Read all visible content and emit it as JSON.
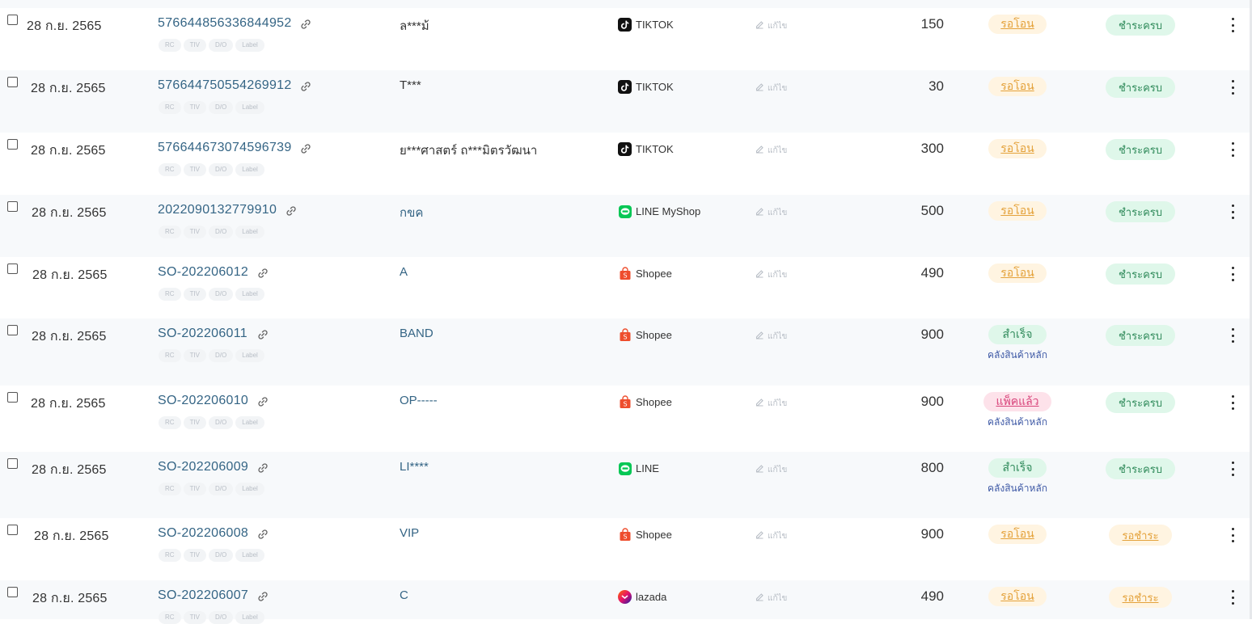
{
  "orders": {
    "tags": [
      "RC",
      "TIV",
      "D/O",
      "Label"
    ],
    "edit_label": "แก้ไข",
    "rows": [
      {
        "date": "28 ก.ย. 2565",
        "order_no": "576644856336844952",
        "customer": "ล***ม้",
        "customer_link": false,
        "platform": "TIKTOK",
        "platform_icon": "tiktok-icon",
        "amount": "150",
        "status": "รอโอน",
        "status_type": "wait",
        "warehouse": "",
        "payment": "ชำระครบ",
        "payment_type": "full"
      },
      {
        "date": "28 ก.ย. 2565",
        "order_no": "576644750554269912",
        "customer": "T***",
        "customer_link": false,
        "platform": "TIKTOK",
        "platform_icon": "tiktok-icon",
        "amount": "30",
        "status": "รอโอน",
        "status_type": "wait",
        "warehouse": "",
        "payment": "ชำระครบ",
        "payment_type": "full"
      },
      {
        "date": "28 ก.ย. 2565",
        "order_no": "576644673074596739",
        "customer": "ย***ศาสตร์ ถ***มิตรวัฒนา",
        "customer_link": false,
        "platform": "TIKTOK",
        "platform_icon": "tiktok-icon",
        "amount": "300",
        "status": "รอโอน",
        "status_type": "wait",
        "warehouse": "",
        "payment": "ชำระครบ",
        "payment_type": "full"
      },
      {
        "date": "28 ก.ย. 2565",
        "order_no": "2022090132779910",
        "customer": "กขค",
        "customer_link": true,
        "platform": "LINE MyShop",
        "platform_icon": "line-icon",
        "amount": "500",
        "status": "รอโอน",
        "status_type": "wait",
        "warehouse": "",
        "payment": "ชำระครบ",
        "payment_type": "full"
      },
      {
        "date": "28 ก.ย. 2565",
        "order_no": "SO-202206012",
        "customer": "A",
        "customer_link": true,
        "platform": "Shopee",
        "platform_icon": "shopee-icon",
        "amount": "490",
        "status": "รอโอน",
        "status_type": "wait",
        "warehouse": "",
        "payment": "ชำระครบ",
        "payment_type": "full"
      },
      {
        "date": "28 ก.ย. 2565",
        "order_no": "SO-202206011",
        "customer": "BAND",
        "customer_link": true,
        "platform": "Shopee",
        "platform_icon": "shopee-icon",
        "amount": "900",
        "status": "สำเร็จ",
        "status_type": "ok",
        "warehouse": "คลังสินค้าหลัก",
        "payment": "ชำระครบ",
        "payment_type": "full"
      },
      {
        "date": "28 ก.ย. 2565",
        "order_no": "SO-202206010",
        "customer": "OP-----",
        "customer_link": true,
        "platform": "Shopee",
        "platform_icon": "shopee-icon",
        "amount": "900",
        "status": "แพ็คแล้ว",
        "status_type": "packed",
        "warehouse": "คลังสินค้าหลัก",
        "payment": "ชำระครบ",
        "payment_type": "full"
      },
      {
        "date": "28 ก.ย. 2565",
        "order_no": "SO-202206009",
        "customer": "LI****",
        "customer_link": true,
        "platform": "LINE",
        "platform_icon": "line-icon",
        "amount": "800",
        "status": "สำเร็จ",
        "status_type": "ok",
        "warehouse": "คลังสินค้าหลัก",
        "payment": "ชำระครบ",
        "payment_type": "full"
      },
      {
        "date": "28 ก.ย. 2565",
        "order_no": "SO-202206008",
        "customer": "VIP",
        "customer_link": true,
        "platform": "Shopee",
        "platform_icon": "shopee-icon",
        "amount": "900",
        "status": "รอโอน",
        "status_type": "wait",
        "warehouse": "",
        "payment": "รอชำระ",
        "payment_type": "pending"
      },
      {
        "date": "28 ก.ย. 2565",
        "order_no": "SO-202206007",
        "customer": "C",
        "customer_link": true,
        "platform": "lazada",
        "platform_icon": "lazada-icon",
        "amount": "490",
        "status": "รอโอน",
        "status_type": "wait",
        "warehouse": "",
        "payment": "รอชำระ",
        "payment_type": "pending"
      }
    ]
  }
}
